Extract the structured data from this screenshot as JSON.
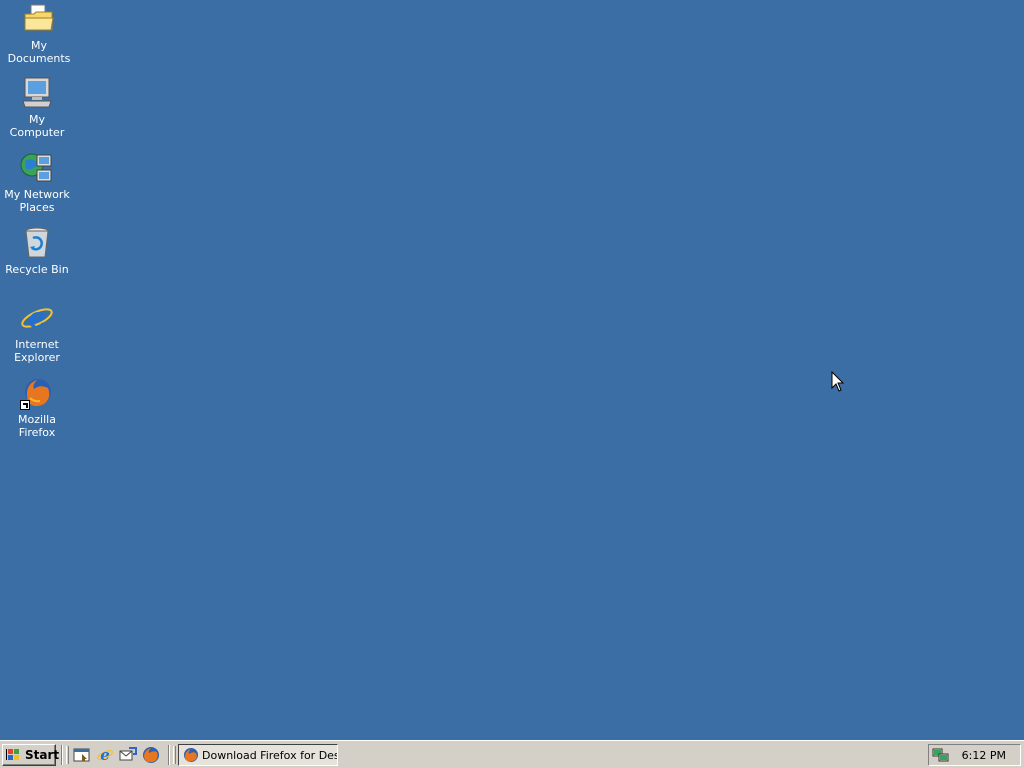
{
  "desktop": {
    "background_color": "#3a6ea5",
    "icons": [
      {
        "label": "My Documents",
        "icon": "folder-documents-icon"
      },
      {
        "label": "My Computer",
        "icon": "computer-icon"
      },
      {
        "label": "My Network Places",
        "icon": "network-places-icon"
      },
      {
        "label": "Recycle Bin",
        "icon": "recycle-bin-icon"
      },
      {
        "label": "Internet Explorer",
        "icon": "internet-explorer-icon"
      },
      {
        "label": "Mozilla Firefox",
        "icon": "firefox-shortcut-icon"
      }
    ]
  },
  "taskbar": {
    "start_label": "Start",
    "quick_launch": [
      "show-desktop-icon",
      "internet-explorer-icon",
      "outlook-express-icon",
      "firefox-icon"
    ],
    "task_button_label": "Download Firefox for Des...",
    "tray": {
      "network_icon": "network-connection-icon",
      "clock": "6:12 PM"
    }
  }
}
